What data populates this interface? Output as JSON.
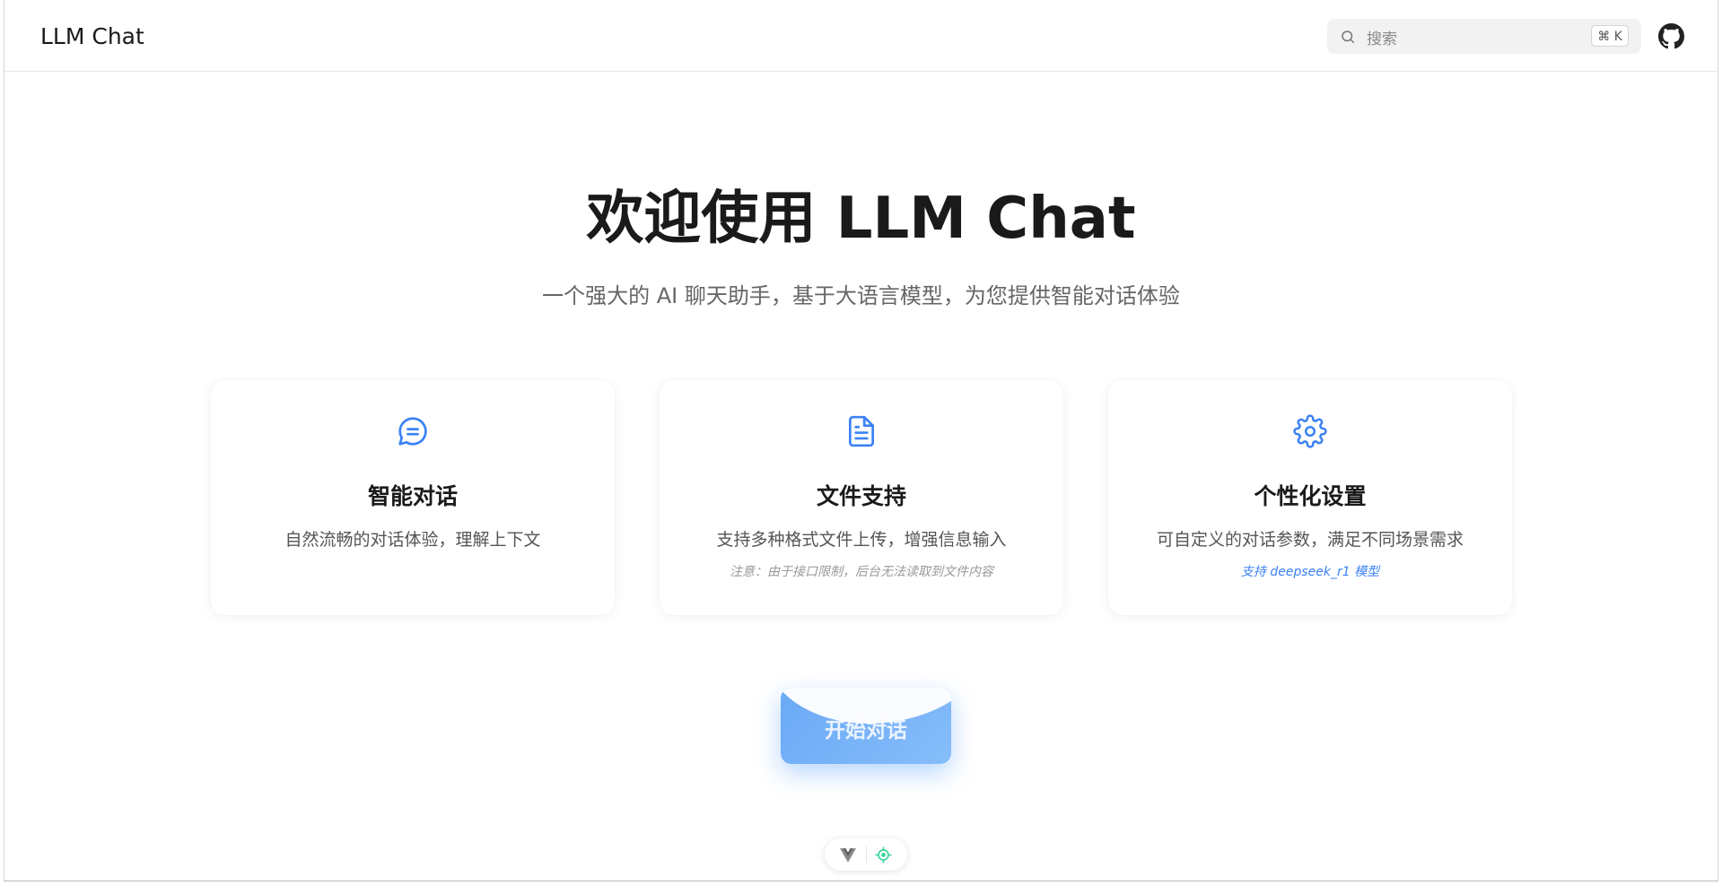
{
  "header": {
    "brand": "LLM Chat",
    "search": {
      "placeholder": "搜索",
      "shortcut": "⌘ K",
      "icon": "search-icon"
    },
    "github_icon": "github-icon"
  },
  "hero": {
    "title": "欢迎使用 LLM Chat",
    "subtitle": "一个强大的 AI 聊天助手，基于大语言模型，为您提供智能对话体验"
  },
  "features": [
    {
      "icon": "chat-bubble-icon",
      "title": "智能对话",
      "description": "自然流畅的对话体验，理解上下文",
      "note": ""
    },
    {
      "icon": "document-icon",
      "title": "文件支持",
      "description": "支持多种格式文件上传，增强信息输入",
      "note": "注意：由于接口限制，后台无法读取到文件内容"
    },
    {
      "icon": "gear-icon",
      "title": "个性化设置",
      "description": "可自定义的对话参数，满足不同场景需求",
      "note": "支持 deepseek_r1 模型"
    }
  ],
  "cta": {
    "label": "开始对话"
  },
  "devtools": {
    "icons": [
      "vue-icon",
      "target-icon"
    ]
  },
  "colors": {
    "accent": "#3b82f6",
    "button": "#7ab4f8",
    "icon": "#3b82f6"
  }
}
